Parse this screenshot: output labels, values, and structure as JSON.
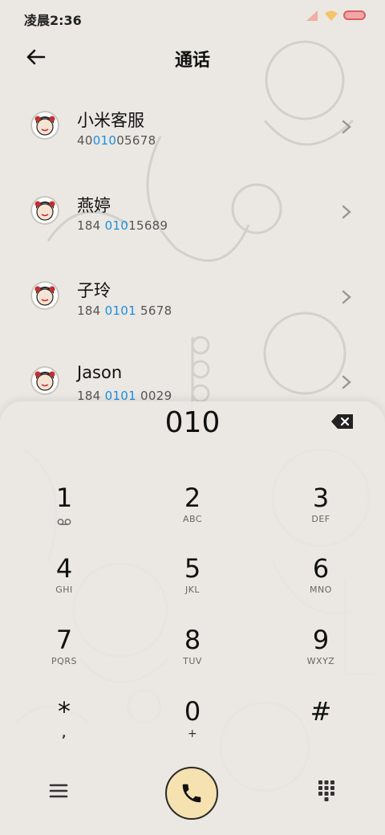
{
  "status_bar": {
    "time": "凌晨2:36"
  },
  "header": {
    "title": "通话"
  },
  "contacts": [
    {
      "name": "小米客服",
      "number_pre": "40",
      "number_hl": "010",
      "number_post": "05678"
    },
    {
      "name": "燕婷",
      "number_pre": "184 ",
      "number_hl": "010",
      "number_post": "15689"
    },
    {
      "name": "子玲",
      "number_pre": "184 ",
      "number_hl": "0101",
      "number_post": " 5678"
    },
    {
      "name": "Jason",
      "number_pre": "184 ",
      "number_hl": "0101",
      "number_post": " 0029"
    }
  ],
  "dialpad": {
    "input": "010",
    "keys": [
      {
        "digit": "1",
        "letters": ""
      },
      {
        "digit": "2",
        "letters": "ABC"
      },
      {
        "digit": "3",
        "letters": "DEF"
      },
      {
        "digit": "4",
        "letters": "GHI"
      },
      {
        "digit": "5",
        "letters": "JKL"
      },
      {
        "digit": "6",
        "letters": "MNO"
      },
      {
        "digit": "7",
        "letters": "PQRS"
      },
      {
        "digit": "8",
        "letters": "TUV"
      },
      {
        "digit": "9",
        "letters": "WXYZ"
      },
      {
        "digit": "*",
        "letters": ","
      },
      {
        "digit": "0",
        "letters": "+"
      },
      {
        "digit": "#",
        "letters": ""
      }
    ]
  },
  "colors": {
    "background": "#ebe8e4",
    "highlight": "#1a8fe0",
    "call_button": "#f5e2b0",
    "battery": "#f2a6a6"
  },
  "icons": {
    "back": "arrow-left-icon",
    "chevron": "chevron-right-icon",
    "backspace": "backspace-icon",
    "voicemail": "voicemail-icon",
    "menu": "hamburger-menu-icon",
    "call": "phone-icon",
    "keypad": "dialpad-icon"
  }
}
